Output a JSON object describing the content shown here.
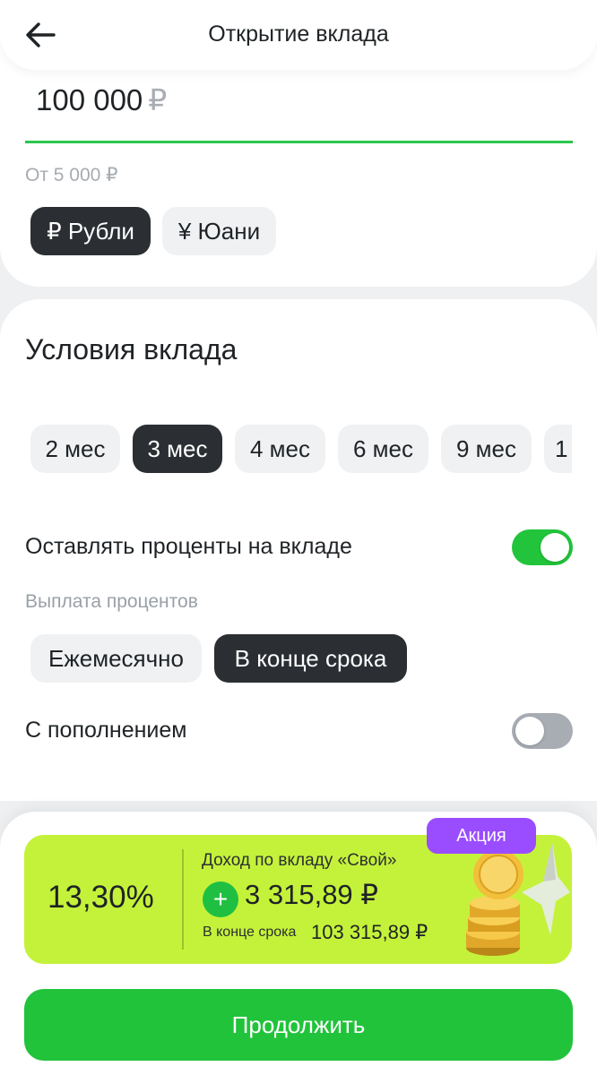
{
  "header": {
    "title": "Открытие вклада"
  },
  "amount": {
    "value": "100 000",
    "currency_sign": "₽",
    "hint": "От 5 000 ₽"
  },
  "currency_options": [
    {
      "label": "₽ Рубли",
      "selected": true
    },
    {
      "label": "¥ Юани",
      "selected": false
    }
  ],
  "conditions": {
    "title": "Условия вклада",
    "terms": [
      {
        "label": "2 мес",
        "selected": false
      },
      {
        "label": "3 мес",
        "selected": true
      },
      {
        "label": "4 мес",
        "selected": false
      },
      {
        "label": "6 мес",
        "selected": false
      },
      {
        "label": "9 мес",
        "selected": false
      },
      {
        "label": "1",
        "selected": false
      }
    ],
    "keep_interest": {
      "label": "Оставлять проценты на вкладе",
      "enabled": true
    },
    "payout": {
      "label": "Выплата процентов",
      "options": [
        {
          "label": "Ежемесячно",
          "selected": false
        },
        {
          "label": "В конце срока",
          "selected": true
        }
      ]
    },
    "replenishment": {
      "label": "С пополнением",
      "enabled": false
    }
  },
  "promo": {
    "badge": "Акция",
    "rate": "13,30%",
    "income_label": "Доход по вкладу «Свой»",
    "plus": "+",
    "income_value": "3 315,89 ₽",
    "total_label": "В конце срока",
    "total_value": "103 315,89 ₽"
  },
  "actions": {
    "continue_label": "Продолжить"
  },
  "colors": {
    "accent_green": "#21c33b",
    "promo_lime": "#c4f23a",
    "badge_purple": "#9a4dff",
    "chip_dark": "#2b2f33",
    "chip_light": "#f0f1f3"
  },
  "icons": {
    "back": "arrow-left-icon",
    "coins": "coins-stack-icon"
  }
}
